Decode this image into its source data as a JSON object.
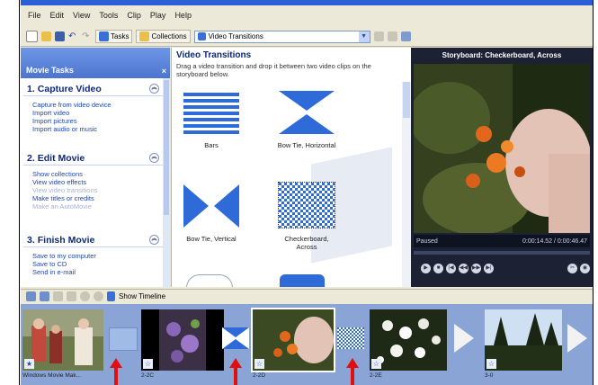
{
  "menu": [
    "File",
    "Edit",
    "View",
    "Tools",
    "Clip",
    "Play",
    "Help"
  ],
  "toolbar": {
    "tasks": "Tasks",
    "collections": "Collections",
    "combo": "Video Transitions"
  },
  "tasks": {
    "header": "Movie Tasks",
    "sections": [
      {
        "num": "1.",
        "title": "Capture Video",
        "links": [
          "Capture from video device",
          "Import video",
          "Import pictures",
          "Import audio or music"
        ]
      },
      {
        "num": "2.",
        "title": "Edit Movie",
        "links": [
          "Show collections",
          "View video effects",
          "View video transitions",
          "Make titles or credits",
          "Make an AutoMovie"
        ]
      },
      {
        "num": "3.",
        "title": "Finish Movie",
        "links": [
          "Save to my computer",
          "Save to CD",
          "Send in e-mail"
        ]
      }
    ]
  },
  "gallery": {
    "title": "Video Transitions",
    "desc": "Drag a video transition and drop it between two video clips on the storyboard below.",
    "tiles": [
      {
        "label": "Bars"
      },
      {
        "label": "Bow Tie, Horizontal"
      },
      {
        "label": "Bow Tie, Vertical"
      },
      {
        "label": "Checkerboard, Across"
      }
    ]
  },
  "monitor": {
    "title": "Storyboard: Checkerboard, Across",
    "status": "Paused",
    "time": "0:00:14.52 / 0:00:46.47"
  },
  "storyboard": {
    "show_timeline": "Show Timeline",
    "clips": [
      {
        "label": "Windows Movie Mak..."
      },
      {
        "label": "2-2C"
      },
      {
        "label": "2-2D"
      },
      {
        "label": "2-2E"
      },
      {
        "label": "3-0"
      }
    ]
  },
  "colors": {
    "accent": "#2a5fd6",
    "arrow": "#e01010",
    "tile_blue": "#2f6bd8"
  }
}
